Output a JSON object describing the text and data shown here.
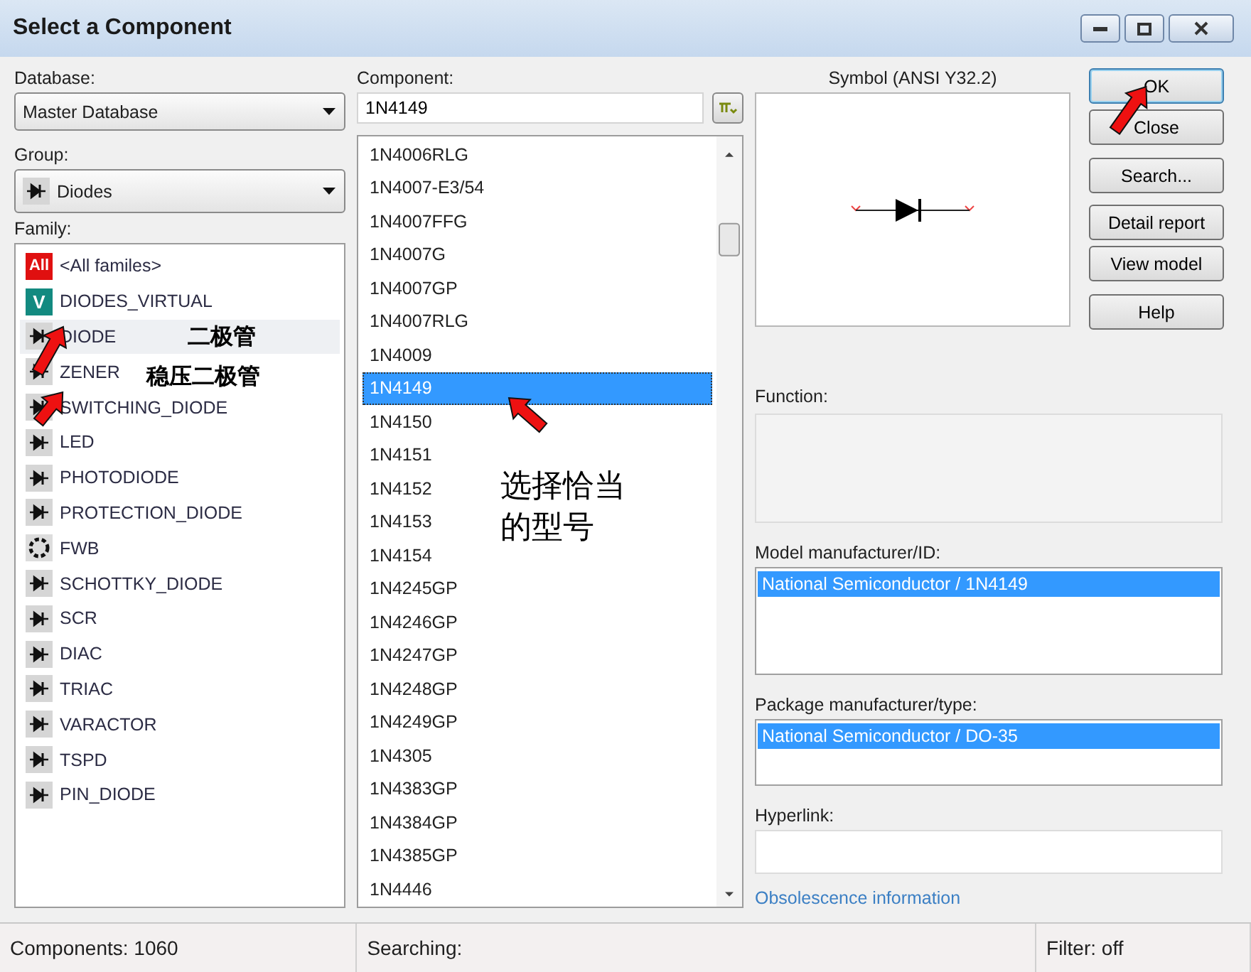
{
  "window": {
    "title": "Select a Component"
  },
  "database": {
    "label": "Database:",
    "value": "Master Database"
  },
  "group": {
    "label": "Group:",
    "value": "Diodes"
  },
  "family": {
    "label": "Family:",
    "items": [
      {
        "label": "<All familes>",
        "kind": "badge",
        "badge": "All",
        "color": "#e01010",
        "selected": false
      },
      {
        "label": "DIODES_VIRTUAL",
        "kind": "badge",
        "badge": "V",
        "color": "#138a80",
        "selected": false
      },
      {
        "label": "DIODE",
        "kind": "symbol",
        "selected": true
      },
      {
        "label": "ZENER",
        "kind": "symbol",
        "selected": false
      },
      {
        "label": "SWITCHING_DIODE",
        "kind": "symbol",
        "selected": false
      },
      {
        "label": "LED",
        "kind": "symbol",
        "selected": false
      },
      {
        "label": "PHOTODIODE",
        "kind": "symbol",
        "selected": false
      },
      {
        "label": "PROTECTION_DIODE",
        "kind": "symbol",
        "selected": false
      },
      {
        "label": "FWB",
        "kind": "bridge",
        "selected": false
      },
      {
        "label": "SCHOTTKY_DIODE",
        "kind": "symbol",
        "selected": false
      },
      {
        "label": "SCR",
        "kind": "symbol",
        "selected": false
      },
      {
        "label": "DIAC",
        "kind": "symbol",
        "selected": false
      },
      {
        "label": "TRIAC",
        "kind": "symbol",
        "selected": false
      },
      {
        "label": "VARACTOR",
        "kind": "symbol",
        "selected": false
      },
      {
        "label": "TSPD",
        "kind": "symbol",
        "selected": false
      },
      {
        "label": "PIN_DIODE",
        "kind": "symbol",
        "selected": false
      }
    ]
  },
  "component": {
    "label": "Component:",
    "value": "1N4149",
    "items": [
      {
        "label": "1N4006RLG",
        "selected": false
      },
      {
        "label": "1N4007-E3/54",
        "selected": false
      },
      {
        "label": "1N4007FFG",
        "selected": false
      },
      {
        "label": "1N4007G",
        "selected": false
      },
      {
        "label": "1N4007GP",
        "selected": false
      },
      {
        "label": "1N4007RLG",
        "selected": false
      },
      {
        "label": "1N4009",
        "selected": false
      },
      {
        "label": "1N4149",
        "selected": true
      },
      {
        "label": "1N4150",
        "selected": false
      },
      {
        "label": "1N4151",
        "selected": false
      },
      {
        "label": "1N4152",
        "selected": false
      },
      {
        "label": "1N4153",
        "selected": false
      },
      {
        "label": "1N4154",
        "selected": false
      },
      {
        "label": "1N4245GP",
        "selected": false
      },
      {
        "label": "1N4246GP",
        "selected": false
      },
      {
        "label": "1N4247GP",
        "selected": false
      },
      {
        "label": "1N4248GP",
        "selected": false
      },
      {
        "label": "1N4249GP",
        "selected": false
      },
      {
        "label": "1N4305",
        "selected": false
      },
      {
        "label": "1N4383GP",
        "selected": false
      },
      {
        "label": "1N4384GP",
        "selected": false
      },
      {
        "label": "1N4385GP",
        "selected": false
      },
      {
        "label": "1N4446",
        "selected": false
      }
    ]
  },
  "symbol": {
    "label": "Symbol (ANSI Y32.2)"
  },
  "buttons": [
    {
      "label": "OK",
      "default": true
    },
    {
      "label": "Close",
      "default": false
    },
    {
      "label": "Search...",
      "default": false
    },
    {
      "label": "Detail report",
      "default": false
    },
    {
      "label": "View model",
      "default": false
    },
    {
      "label": "Help",
      "default": false
    }
  ],
  "function": {
    "label": "Function:"
  },
  "model": {
    "label": "Model manufacturer/ID:",
    "items": [
      {
        "label": "National Semiconductor / 1N4149",
        "selected": true
      }
    ]
  },
  "package": {
    "label": "Package manufacturer/type:",
    "items": [
      {
        "label": "National Semiconductor / DO-35",
        "selected": true
      }
    ]
  },
  "hyperlink": {
    "label": "Hyperlink:"
  },
  "obsolescence_link": "Obsolescence information",
  "status_bar": [
    "Components: 1060",
    "Searching:",
    "Filter: off"
  ],
  "annotations": [
    {
      "text": "二极管"
    },
    {
      "text": "稳压二极管"
    },
    {
      "text": "选择恰当的型号"
    }
  ]
}
